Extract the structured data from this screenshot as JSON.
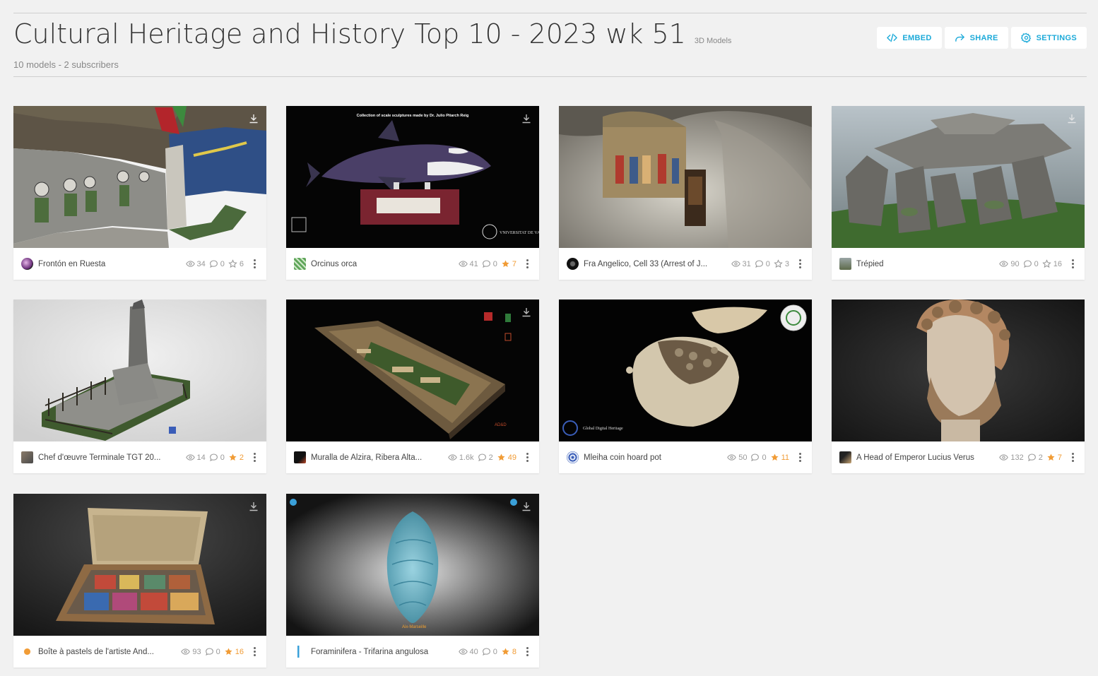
{
  "header": {
    "title": "Cultural Heritage and History Top 10 - 2023 wk 51",
    "type_label": "3D Models",
    "subtitle": "10 models - 2 subscribers",
    "actions": {
      "embed": "EMBED",
      "share": "SHARE",
      "settings": "SETTINGS"
    }
  },
  "colors": {
    "accent": "#1caad9",
    "liked": "#f19c36",
    "background": "#f1f1f1"
  },
  "models": [
    {
      "name": "Frontón en Ruesta",
      "views": "34",
      "comments": "0",
      "likes": "6",
      "liked": false
    },
    {
      "name": "Orcinus orca",
      "views": "41",
      "comments": "0",
      "likes": "7",
      "liked": true,
      "thumb_text": "Collection of scale sculptures made by Dr. Julio Pitarch Reig",
      "thumb_brand": "VNIVERSITAT DE VALÈNCIA"
    },
    {
      "name": "Fra Angelico, Cell 33 (Arrest of J...",
      "views": "31",
      "comments": "0",
      "likes": "3",
      "liked": false
    },
    {
      "name": "Trépied",
      "views": "90",
      "comments": "0",
      "likes": "16",
      "liked": false
    },
    {
      "name": "Chef d'œuvre Terminale TGT 20...",
      "views": "14",
      "comments": "0",
      "likes": "2",
      "liked": true
    },
    {
      "name": "Muralla de Alzira, Ribera Alta...",
      "views": "1.6k",
      "comments": "2",
      "likes": "49",
      "liked": true
    },
    {
      "name": "Mleiha coin hoard pot",
      "views": "50",
      "comments": "0",
      "likes": "11",
      "liked": true,
      "thumb_brand": "Global Digital Heritage"
    },
    {
      "name": "A Head of Emperor Lucius Verus",
      "views": "132",
      "comments": "2",
      "likes": "7",
      "liked": true
    },
    {
      "name": "Boîte à pastels de l'artiste And...",
      "views": "93",
      "comments": "0",
      "likes": "16",
      "liked": true
    },
    {
      "name": "Foraminifera - Trifarina angulosa",
      "views": "40",
      "comments": "0",
      "likes": "8",
      "liked": true
    }
  ]
}
